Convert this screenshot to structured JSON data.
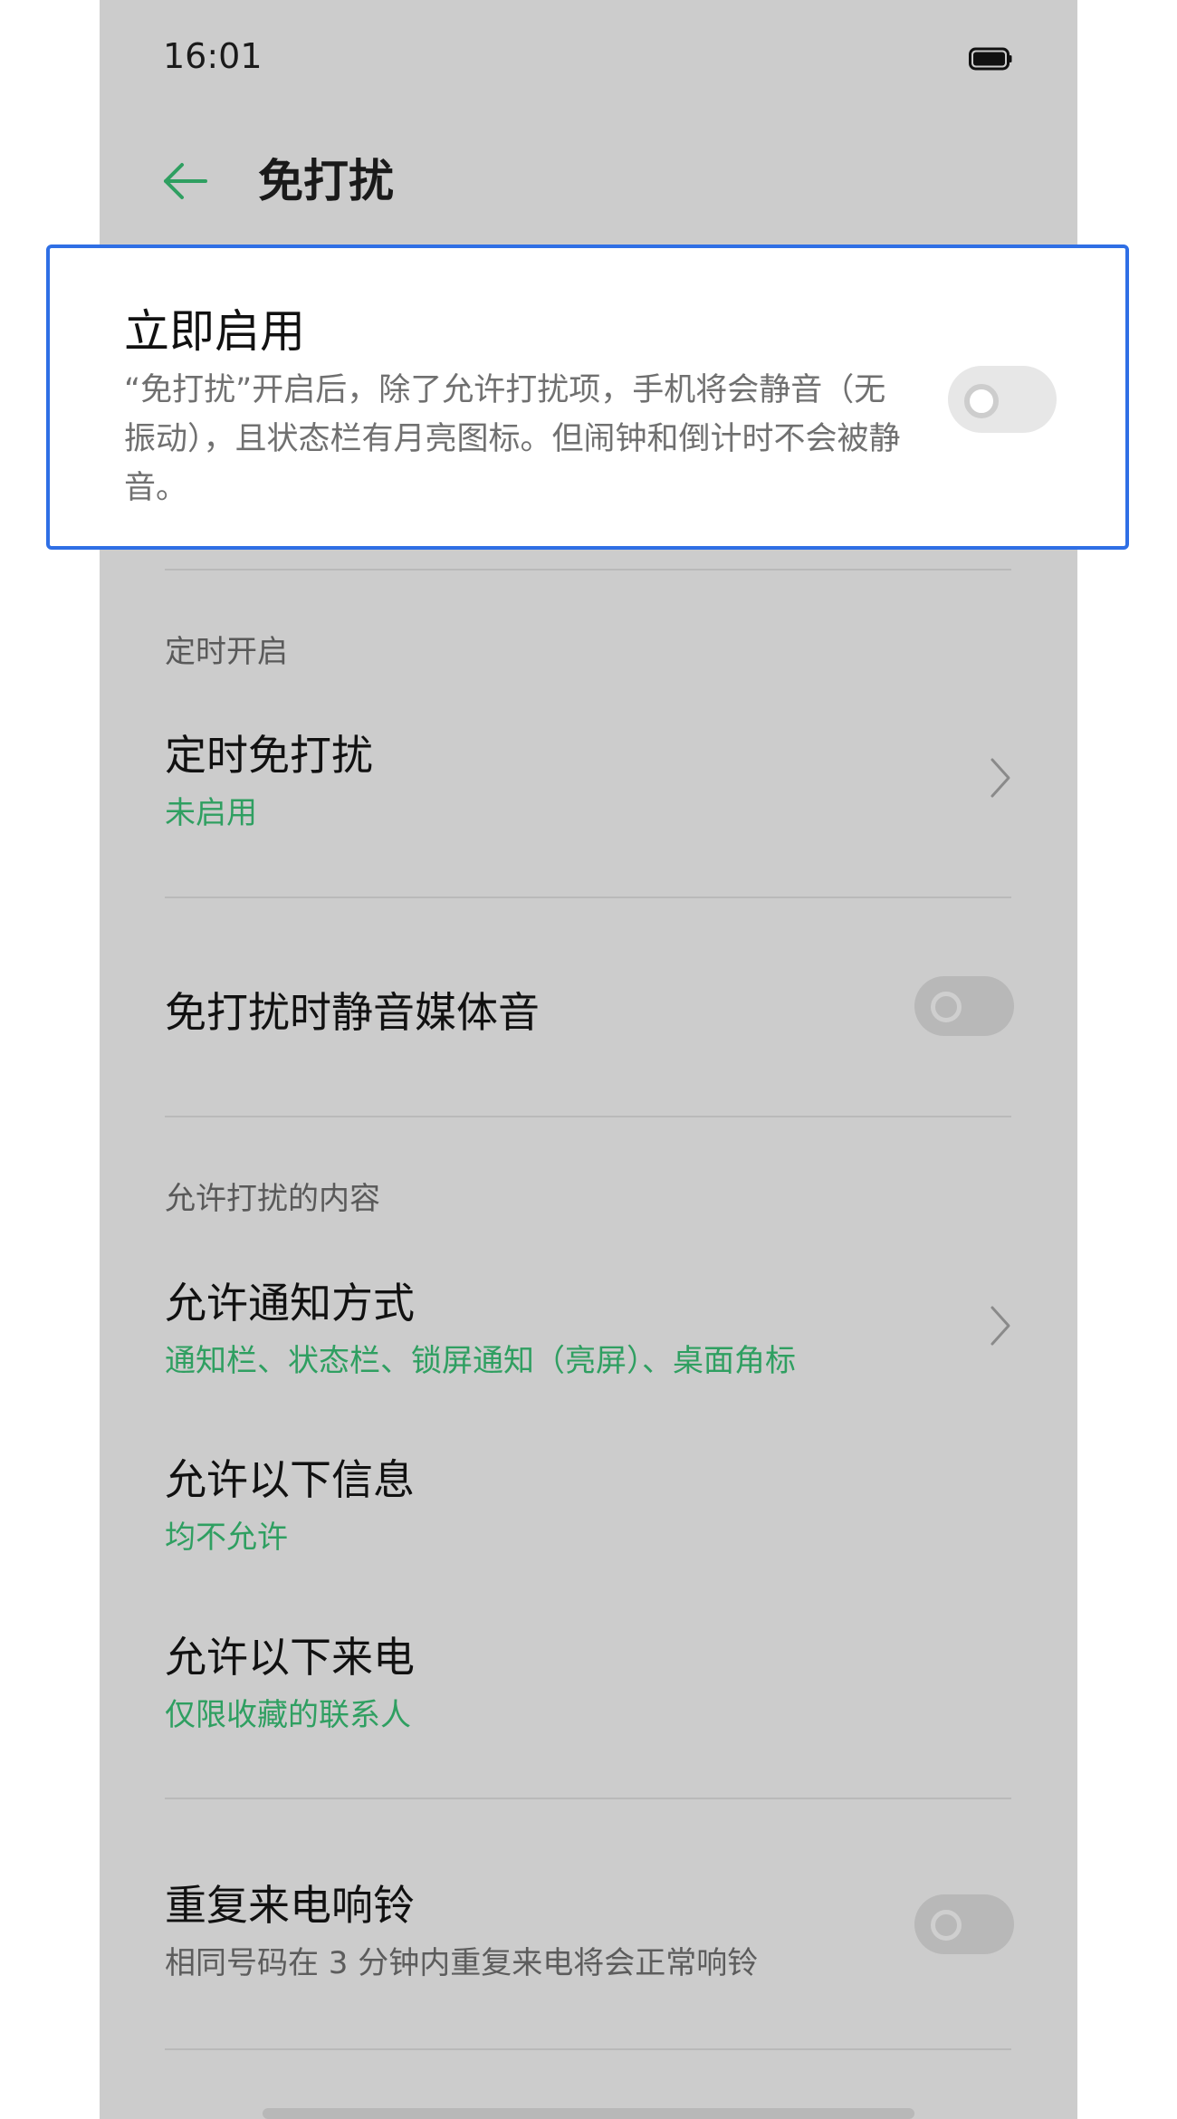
{
  "status_bar": {
    "time": "16:01",
    "battery_icon": "battery-icon"
  },
  "app_bar": {
    "back_icon": "back-arrow-icon",
    "title": "免打扰"
  },
  "highlight": {
    "title": "立即启用",
    "description": "“免打扰”开启后，除了允许打扰项，手机将会静音（无振动），且状态栏有月亮图标。但闹钟和倒计时不会被静音。",
    "toggle_on": false
  },
  "schedule_section": {
    "header": "定时开启",
    "item_title": "定时免打扰",
    "item_status": "未启用"
  },
  "mute_media": {
    "title": "免打扰时静音媒体音",
    "toggle_on": false
  },
  "allow_section": {
    "header": "允许打扰的内容",
    "notification": {
      "title": "允许通知方式",
      "value": "通知栏、状态栏、锁屏通知（亮屏）、桌面角标"
    },
    "messages": {
      "title": "允许以下信息",
      "value": "均不允许"
    },
    "calls": {
      "title": "允许以下来电",
      "value": "仅限收藏的联系人"
    }
  },
  "repeat_calls": {
    "title": "重复来电响铃",
    "description": "相同号码在 3 分钟内重复来电将会正常响铃",
    "toggle_on": false
  },
  "colors": {
    "accent": "#2f9f61",
    "highlight_border": "#2f6fe5",
    "overlay_bg": "#cccccc"
  }
}
